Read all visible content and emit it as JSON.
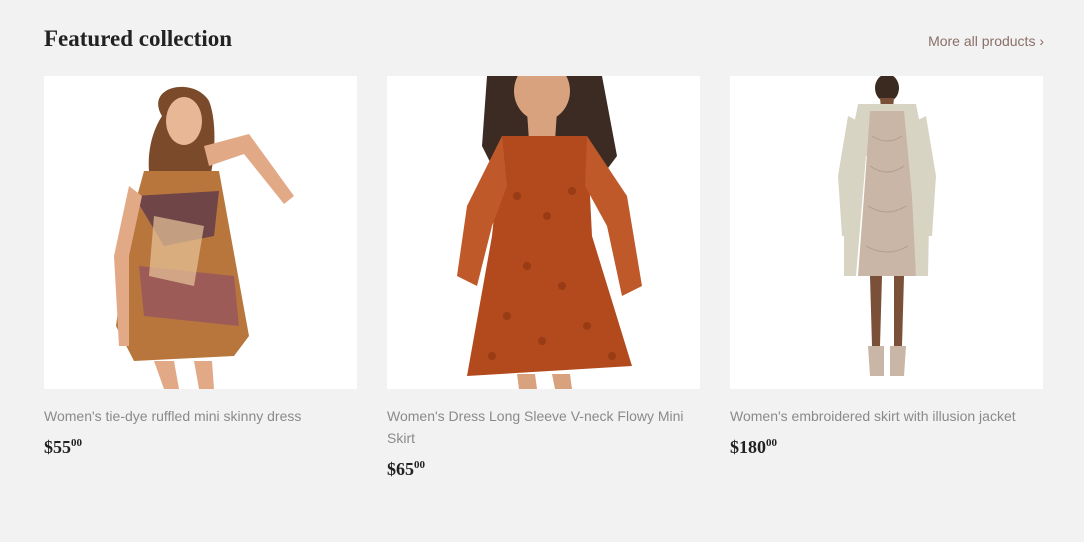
{
  "section": {
    "title": "Featured collection",
    "more_link": "More all products ›"
  },
  "products": [
    {
      "title": "Women's tie-dye ruffled mini skinny dress",
      "price_main": "$55",
      "price_cents": "00",
      "image_desc": "tie-dye-dress-photo"
    },
    {
      "title": "Women's Dress Long Sleeve V-neck Flowy Mini Skirt",
      "price_main": "$65",
      "price_cents": "00",
      "image_desc": "orange-polka-dot-dress-photo"
    },
    {
      "title": "Women's embroidered skirt with illusion jacket",
      "price_main": "$180",
      "price_cents": "00",
      "image_desc": "embroidered-dress-jacket-photo"
    }
  ],
  "colors": {
    "background": "#f2f2f2",
    "link": "#8a6f68",
    "product_title": "#8a8a8a",
    "heading": "#222222"
  }
}
